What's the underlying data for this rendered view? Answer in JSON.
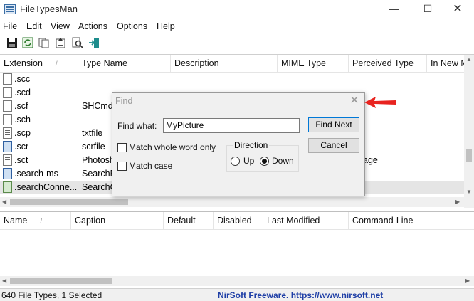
{
  "window": {
    "title": "FileTypesMan"
  },
  "window_controls": {
    "minimize": "—",
    "maximize": "☐",
    "close": "✕"
  },
  "menu": [
    "File",
    "Edit",
    "View",
    "Actions",
    "Options",
    "Help"
  ],
  "toolbar_icons": [
    "save-icon",
    "refresh-icon",
    "copy-icon",
    "properties-icon",
    "find-icon",
    "exit-icon"
  ],
  "upper_table": {
    "columns": [
      "Extension",
      "Type Name",
      "Description",
      "MIME Type",
      "Perceived Type",
      "In New M"
    ],
    "sort_mark": "/",
    "rows": [
      {
        "ext": ".scc",
        "type": "",
        "perceived": "",
        "icon": "file-blank-icon"
      },
      {
        "ext": ".scd",
        "type": "",
        "perceived": "",
        "icon": "file-blank-icon"
      },
      {
        "ext": ".scf",
        "type": "SHCmdl",
        "perceived": "",
        "icon": "file-blank-icon"
      },
      {
        "ext": ".sch",
        "type": "",
        "perceived": "",
        "icon": "file-blank-icon"
      },
      {
        "ext": ".scp",
        "type": "txtfile",
        "perceived": "",
        "icon": "text-file-icon"
      },
      {
        "ext": ".scr",
        "type": "scrfile",
        "perceived": "",
        "icon": "screensaver-file-icon"
      },
      {
        "ext": ".sct",
        "type": "Photosh",
        "perceived": "age",
        "icon": "script-file-icon"
      },
      {
        "ext": ".search-ms",
        "type": "SearchF",
        "perceived": "",
        "icon": "search-file-icon"
      },
      {
        "ext": ".searchConne...",
        "type": "SearchC",
        "perceived": "",
        "icon": "search-connector-icon"
      }
    ]
  },
  "lower_table": {
    "columns": [
      "Name",
      "Caption",
      "Default",
      "Disabled",
      "Last Modified",
      "Command-Line"
    ],
    "sort_mark": "/"
  },
  "status": {
    "left": "640 File Types, 1 Selected",
    "right": "NirSoft Freeware. https://www.nirsoft.net"
  },
  "find_dialog": {
    "title": "Find",
    "close": "✕",
    "find_what_label": "Find what:",
    "find_what_value": "MyPicture",
    "find_next": "Find Next",
    "cancel": "Cancel",
    "match_whole_word": "Match whole word only",
    "match_case": "Match case",
    "direction_label": "Direction",
    "up": "Up",
    "down": "Down",
    "direction_selected": "Down",
    "match_whole_word_checked": false,
    "match_case_checked": false
  },
  "annotation": {
    "arrow_color": "#e8231f"
  }
}
